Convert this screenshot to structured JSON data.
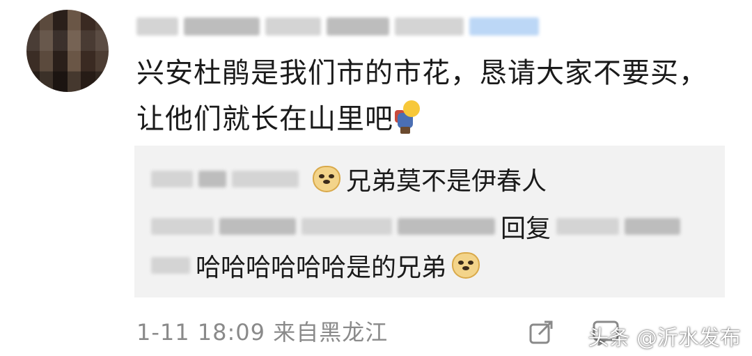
{
  "comment": {
    "text_line1": "兴安杜鹃是我们市的市花，恳请大家不要买，",
    "text_line2": "让他们就长在山里吧",
    "emoji": "bowing-person-emoji"
  },
  "replies": [
    {
      "text": "兄弟莫不是伊春人",
      "emoji": "doge-emoji"
    },
    {
      "reply_label": "回复"
    },
    {
      "text": "哈哈哈哈哈哈是的兄弟",
      "emoji": "doge-emoji"
    }
  ],
  "footer": {
    "meta": "1-11 18:09  来自黑龙江",
    "icons": [
      "share-icon",
      "comment-icon"
    ]
  },
  "watermark": "头条 @沂水发布"
}
